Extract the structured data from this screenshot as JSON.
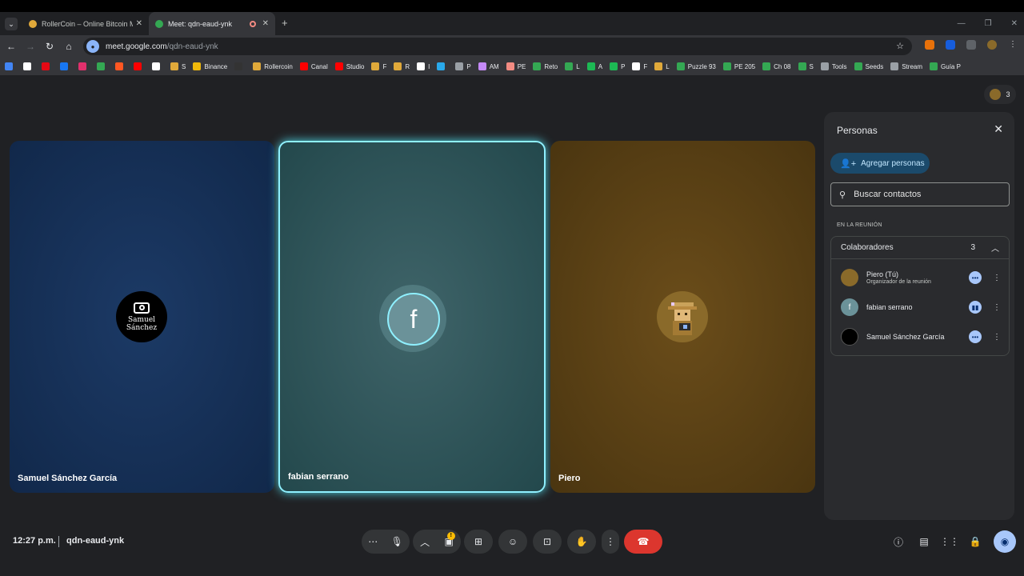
{
  "tabs": [
    {
      "title": "RollerCoin – Online Bitcoin Mi",
      "favicon_color": "#e0a93a"
    },
    {
      "title": "Meet: qdn-eaud-ynk",
      "favicon_color": "#34a853"
    }
  ],
  "omnibox": {
    "host": "meet.google.com",
    "path": "/qdn-eaud-ynk"
  },
  "bookmarks": [
    {
      "label": "",
      "color": "#4285f4"
    },
    {
      "label": "",
      "color": "#ffffff"
    },
    {
      "label": "",
      "color": "#e50914"
    },
    {
      "label": "",
      "color": "#1877f2"
    },
    {
      "label": "",
      "color": "#e1306c"
    },
    {
      "label": "",
      "color": "#34a853"
    },
    {
      "label": "",
      "color": "#ff5722"
    },
    {
      "label": "",
      "color": "#ff0000"
    },
    {
      "label": "",
      "color": "#ffffff"
    },
    {
      "label": "S",
      "color": "#e0a93a"
    },
    {
      "label": "Binance",
      "color": "#f0b90b"
    },
    {
      "label": "",
      "color": "#333333"
    },
    {
      "label": "Rollercoin",
      "color": "#e0a93a"
    },
    {
      "label": "Canal",
      "color": "#ff0000"
    },
    {
      "label": "Studio",
      "color": "#ff0000"
    },
    {
      "label": "F",
      "color": "#e0a93a"
    },
    {
      "label": "R",
      "color": "#e0a93a"
    },
    {
      "label": "I",
      "color": "#ffffff"
    },
    {
      "label": "",
      "color": "#29a9eb"
    },
    {
      "label": "P",
      "color": "#9aa0a6"
    },
    {
      "label": "AM",
      "color": "#c58af9"
    },
    {
      "label": "PE",
      "color": "#f28b82"
    },
    {
      "label": "Reto",
      "color": "#34a853"
    },
    {
      "label": "L",
      "color": "#34a853"
    },
    {
      "label": "A",
      "color": "#1db954"
    },
    {
      "label": "P",
      "color": "#1db954"
    },
    {
      "label": "F",
      "color": "#ffffff"
    },
    {
      "label": "L",
      "color": "#e0a93a"
    },
    {
      "label": "Puzzle 93",
      "color": "#34a853"
    },
    {
      "label": "PE 205",
      "color": "#34a853"
    },
    {
      "label": "Ch 08",
      "color": "#34a853"
    },
    {
      "label": "S",
      "color": "#34a853"
    },
    {
      "label": "Tools",
      "color": "#9aa0a6"
    },
    {
      "label": "Seeds",
      "color": "#34a853"
    },
    {
      "label": "Stream",
      "color": "#9aa0a6"
    },
    {
      "label": "Guía P",
      "color": "#34a853"
    }
  ],
  "participant_count": "3",
  "tiles": {
    "samuel": {
      "name": "Samuel Sánchez García",
      "avatar_line1": "Samuel",
      "avatar_line2": "Sánchez"
    },
    "fabian": {
      "name": "fabian serrano",
      "avatar_letter": "f"
    },
    "piero": {
      "name": "Piero"
    }
  },
  "panel": {
    "title": "Personas",
    "add_label": "Agregar personas",
    "search_placeholder": "Buscar contactos",
    "section_label": "EN LA REUNIÓN",
    "group_title": "Colaboradores",
    "group_count": "3",
    "people": [
      {
        "name": "Piero (Tú)",
        "subtitle": "Organizador de la reunión",
        "avatar": "piero",
        "status": "more-dots"
      },
      {
        "name": "fabian serrano",
        "subtitle": "",
        "avatar": "f",
        "status": "speaking"
      },
      {
        "name": "Samuel Sánchez García",
        "subtitle": "",
        "avatar": "samuel",
        "status": "more-dots"
      }
    ]
  },
  "bottom": {
    "time": "12:27 p.m.",
    "meeting_code": "qdn-eaud-ynk"
  },
  "colors": {
    "end_call": "#dc362e",
    "accent": "#a8c7fa",
    "speaking_border": "#8ff0ff"
  }
}
